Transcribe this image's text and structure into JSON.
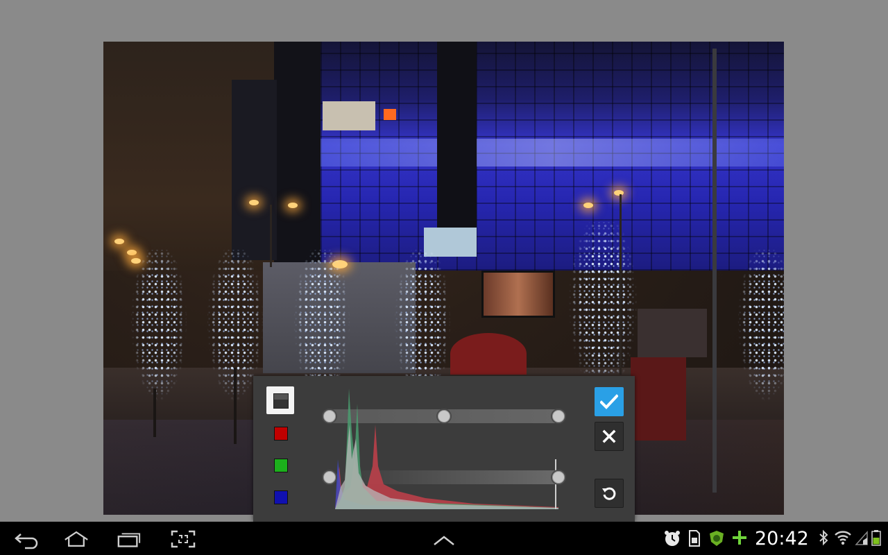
{
  "app": {
    "name": "photo-curves-editor"
  },
  "curves": {
    "channels": [
      {
        "id": "rgb",
        "selected": true
      },
      {
        "id": "red",
        "color": "#c00000",
        "selected": false
      },
      {
        "id": "green",
        "color": "#1cb01c",
        "selected": false
      },
      {
        "id": "blue",
        "color": "#1010b0",
        "selected": false
      }
    ],
    "output_curve_points": [
      0.0,
      0.5,
      1.0
    ],
    "input_levels": [
      0.0,
      1.0
    ],
    "histogram_peaks": {
      "blue_peak": 0.18,
      "green_peak": 0.09,
      "red_peak": 0.37
    },
    "accent_color": "#2aa0e6"
  },
  "actions": {
    "apply": "check-icon",
    "cancel": "close-icon",
    "reset": "rotate-reset-icon"
  },
  "navbar": {
    "back": "back-icon",
    "home": "home-icon",
    "recents": "recent-apps-icon",
    "screenshot": "screenshot-icon",
    "up": "chevron-up-icon"
  },
  "status": {
    "time": "20:42",
    "battery_color": "#7ec11f"
  }
}
